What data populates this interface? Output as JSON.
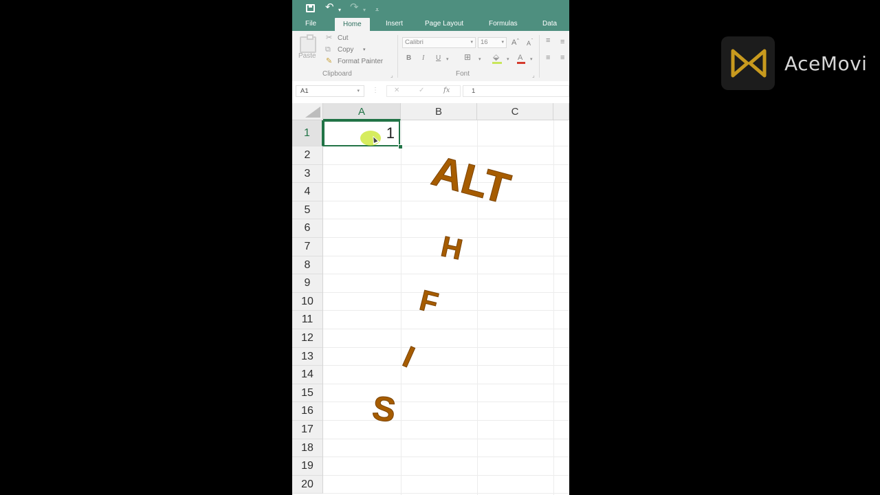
{
  "quick_access": {
    "save_icon": "save-icon",
    "undo_icon": "undo-icon",
    "redo_icon": "redo-icon",
    "undo_glyph": "↶",
    "redo_glyph": "↷",
    "dropdown_glyph": "▾",
    "customize_glyph": "⩡"
  },
  "tabs": [
    {
      "label": "File"
    },
    {
      "label": "Home",
      "active": true
    },
    {
      "label": "Insert"
    },
    {
      "label": "Page Layout"
    },
    {
      "label": "Formulas"
    },
    {
      "label": "Data"
    }
  ],
  "ribbon": {
    "clipboard": {
      "paste_label": "Paste",
      "cut_label": "Cut",
      "copy_label": "Copy",
      "format_painter_label": "Format Painter",
      "group_label": "Clipboard"
    },
    "font": {
      "font_name": "Calibri",
      "font_size": "16",
      "grow_label": "A",
      "shrink_label": "A",
      "bold_label": "B",
      "italic_label": "I",
      "underline_label": "U",
      "font_color_label": "A",
      "group_label": "Font"
    }
  },
  "formula_bar": {
    "name_box": "A1",
    "cancel_glyph": "✕",
    "enter_glyph": "✓",
    "fx_label": "fx",
    "value": "1"
  },
  "grid": {
    "columns": [
      "A",
      "B",
      "C"
    ],
    "rows": [
      "1",
      "2",
      "3",
      "4",
      "5",
      "6",
      "7",
      "8",
      "9",
      "10",
      "11",
      "12",
      "13",
      "14",
      "15",
      "16",
      "17",
      "18",
      "19",
      "20"
    ],
    "active_cell": "A1",
    "active_cell_value": "1"
  },
  "overlay_text": {
    "alt": "ALT",
    "h": "H",
    "f": "F",
    "i": "I",
    "s": "S"
  },
  "watermark": {
    "brand": "AceMovi"
  },
  "colors": {
    "ribbon_green": "#4e8f7f",
    "excel_green": "#217346",
    "overlay_brown": "#a65c00"
  }
}
